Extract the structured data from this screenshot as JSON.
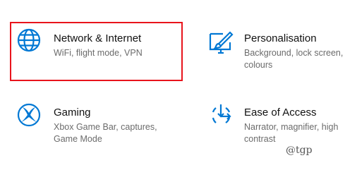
{
  "accent_color": "#0078d4",
  "highlight_color": "#e8141c",
  "tiles": [
    {
      "icon": "globe-icon",
      "title": "Network & Internet",
      "description": "WiFi, flight mode, VPN"
    },
    {
      "icon": "personalisation-icon",
      "title": "Personalisation",
      "description": "Background, lock screen, colours"
    },
    {
      "icon": "xbox-icon",
      "title": "Gaming",
      "description": "Xbox Game Bar, captures, Game Mode"
    },
    {
      "icon": "ease-of-access-icon",
      "title": "Ease of Access",
      "description": "Narrator, magnifier, high contrast"
    }
  ],
  "watermark": "@tgp"
}
